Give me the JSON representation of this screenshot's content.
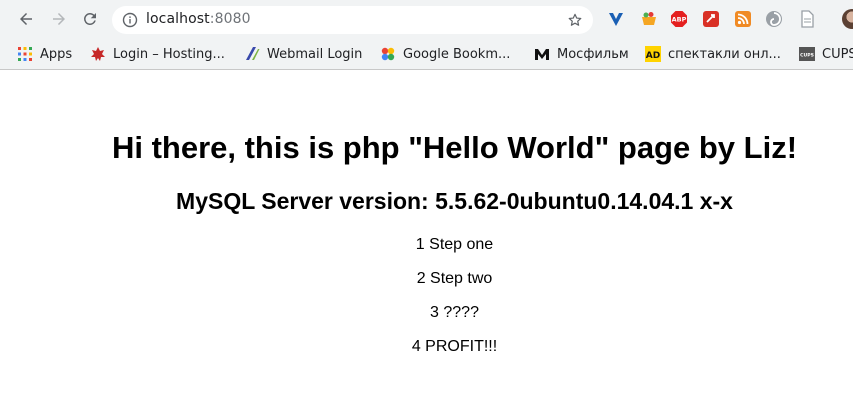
{
  "browser": {
    "address": {
      "host": "localhost",
      "port": ":8080"
    },
    "bookmarks": [
      {
        "label": "Apps",
        "icon": "apps-grid-icon"
      },
      {
        "label": "Login – Hosting...",
        "icon": "hosting-leaf-icon"
      },
      {
        "label": "Webmail Login",
        "icon": "webmail-icon"
      },
      {
        "label": "Google Bookm...",
        "icon": "google-bookmarks-icon"
      },
      {
        "label": "Мосфильм",
        "icon": "mosfilm-icon"
      },
      {
        "label": "спектакли онл...",
        "icon": "ad-icon",
        "icon_text": "AD"
      },
      {
        "label": "CUPS",
        "icon": "cups-icon",
        "icon_text": "CUPS"
      }
    ],
    "extensions": [
      {
        "name": "v-shield-icon"
      },
      {
        "name": "basket-icon"
      },
      {
        "name": "adblock-plus-icon",
        "text": "ABP"
      },
      {
        "name": "red-badge-icon"
      },
      {
        "name": "rss-icon"
      },
      {
        "name": "swirl-icon"
      },
      {
        "name": "page-icon"
      }
    ],
    "accent_colors": {
      "toolbar_bg": "#f1f3f4",
      "abp_red": "#e41f1f",
      "rss_orange": "#f08a24",
      "ad_yellow": "#ffd300"
    }
  },
  "page": {
    "title": "Hi there, this is php \"Hello World\" page by Liz!",
    "subtitle": "MySQL Server version: 5.5.62-0ubuntu0.14.04.1 x-x",
    "steps": [
      "1 Step one",
      "2 Step two",
      "3 ????",
      "4 PROFIT!!!"
    ]
  }
}
